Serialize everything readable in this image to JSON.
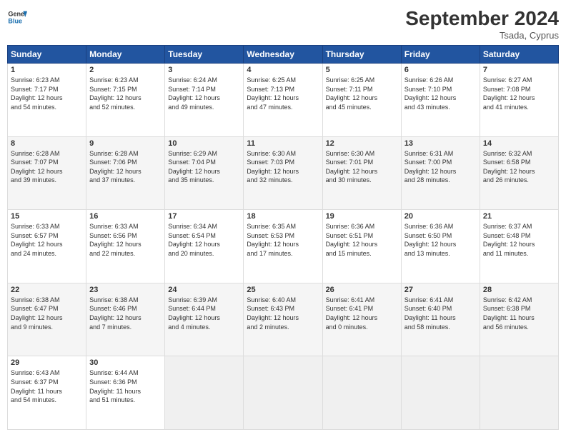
{
  "header": {
    "logo_line1": "General",
    "logo_line2": "Blue",
    "month_title": "September 2024",
    "location": "Tsada, Cyprus"
  },
  "weekdays": [
    "Sunday",
    "Monday",
    "Tuesday",
    "Wednesday",
    "Thursday",
    "Friday",
    "Saturday"
  ],
  "weeks": [
    [
      {
        "day": "1",
        "info": "Sunrise: 6:23 AM\nSunset: 7:17 PM\nDaylight: 12 hours\nand 54 minutes."
      },
      {
        "day": "2",
        "info": "Sunrise: 6:23 AM\nSunset: 7:15 PM\nDaylight: 12 hours\nand 52 minutes."
      },
      {
        "day": "3",
        "info": "Sunrise: 6:24 AM\nSunset: 7:14 PM\nDaylight: 12 hours\nand 49 minutes."
      },
      {
        "day": "4",
        "info": "Sunrise: 6:25 AM\nSunset: 7:13 PM\nDaylight: 12 hours\nand 47 minutes."
      },
      {
        "day": "5",
        "info": "Sunrise: 6:25 AM\nSunset: 7:11 PM\nDaylight: 12 hours\nand 45 minutes."
      },
      {
        "day": "6",
        "info": "Sunrise: 6:26 AM\nSunset: 7:10 PM\nDaylight: 12 hours\nand 43 minutes."
      },
      {
        "day": "7",
        "info": "Sunrise: 6:27 AM\nSunset: 7:08 PM\nDaylight: 12 hours\nand 41 minutes."
      }
    ],
    [
      {
        "day": "8",
        "info": "Sunrise: 6:28 AM\nSunset: 7:07 PM\nDaylight: 12 hours\nand 39 minutes."
      },
      {
        "day": "9",
        "info": "Sunrise: 6:28 AM\nSunset: 7:06 PM\nDaylight: 12 hours\nand 37 minutes."
      },
      {
        "day": "10",
        "info": "Sunrise: 6:29 AM\nSunset: 7:04 PM\nDaylight: 12 hours\nand 35 minutes."
      },
      {
        "day": "11",
        "info": "Sunrise: 6:30 AM\nSunset: 7:03 PM\nDaylight: 12 hours\nand 32 minutes."
      },
      {
        "day": "12",
        "info": "Sunrise: 6:30 AM\nSunset: 7:01 PM\nDaylight: 12 hours\nand 30 minutes."
      },
      {
        "day": "13",
        "info": "Sunrise: 6:31 AM\nSunset: 7:00 PM\nDaylight: 12 hours\nand 28 minutes."
      },
      {
        "day": "14",
        "info": "Sunrise: 6:32 AM\nSunset: 6:58 PM\nDaylight: 12 hours\nand 26 minutes."
      }
    ],
    [
      {
        "day": "15",
        "info": "Sunrise: 6:33 AM\nSunset: 6:57 PM\nDaylight: 12 hours\nand 24 minutes."
      },
      {
        "day": "16",
        "info": "Sunrise: 6:33 AM\nSunset: 6:56 PM\nDaylight: 12 hours\nand 22 minutes."
      },
      {
        "day": "17",
        "info": "Sunrise: 6:34 AM\nSunset: 6:54 PM\nDaylight: 12 hours\nand 20 minutes."
      },
      {
        "day": "18",
        "info": "Sunrise: 6:35 AM\nSunset: 6:53 PM\nDaylight: 12 hours\nand 17 minutes."
      },
      {
        "day": "19",
        "info": "Sunrise: 6:36 AM\nSunset: 6:51 PM\nDaylight: 12 hours\nand 15 minutes."
      },
      {
        "day": "20",
        "info": "Sunrise: 6:36 AM\nSunset: 6:50 PM\nDaylight: 12 hours\nand 13 minutes."
      },
      {
        "day": "21",
        "info": "Sunrise: 6:37 AM\nSunset: 6:48 PM\nDaylight: 12 hours\nand 11 minutes."
      }
    ],
    [
      {
        "day": "22",
        "info": "Sunrise: 6:38 AM\nSunset: 6:47 PM\nDaylight: 12 hours\nand 9 minutes."
      },
      {
        "day": "23",
        "info": "Sunrise: 6:38 AM\nSunset: 6:46 PM\nDaylight: 12 hours\nand 7 minutes."
      },
      {
        "day": "24",
        "info": "Sunrise: 6:39 AM\nSunset: 6:44 PM\nDaylight: 12 hours\nand 4 minutes."
      },
      {
        "day": "25",
        "info": "Sunrise: 6:40 AM\nSunset: 6:43 PM\nDaylight: 12 hours\nand 2 minutes."
      },
      {
        "day": "26",
        "info": "Sunrise: 6:41 AM\nSunset: 6:41 PM\nDaylight: 12 hours\nand 0 minutes."
      },
      {
        "day": "27",
        "info": "Sunrise: 6:41 AM\nSunset: 6:40 PM\nDaylight: 11 hours\nand 58 minutes."
      },
      {
        "day": "28",
        "info": "Sunrise: 6:42 AM\nSunset: 6:38 PM\nDaylight: 11 hours\nand 56 minutes."
      }
    ],
    [
      {
        "day": "29",
        "info": "Sunrise: 6:43 AM\nSunset: 6:37 PM\nDaylight: 11 hours\nand 54 minutes."
      },
      {
        "day": "30",
        "info": "Sunrise: 6:44 AM\nSunset: 6:36 PM\nDaylight: 11 hours\nand 51 minutes."
      },
      {
        "day": "",
        "info": ""
      },
      {
        "day": "",
        "info": ""
      },
      {
        "day": "",
        "info": ""
      },
      {
        "day": "",
        "info": ""
      },
      {
        "day": "",
        "info": ""
      }
    ]
  ]
}
